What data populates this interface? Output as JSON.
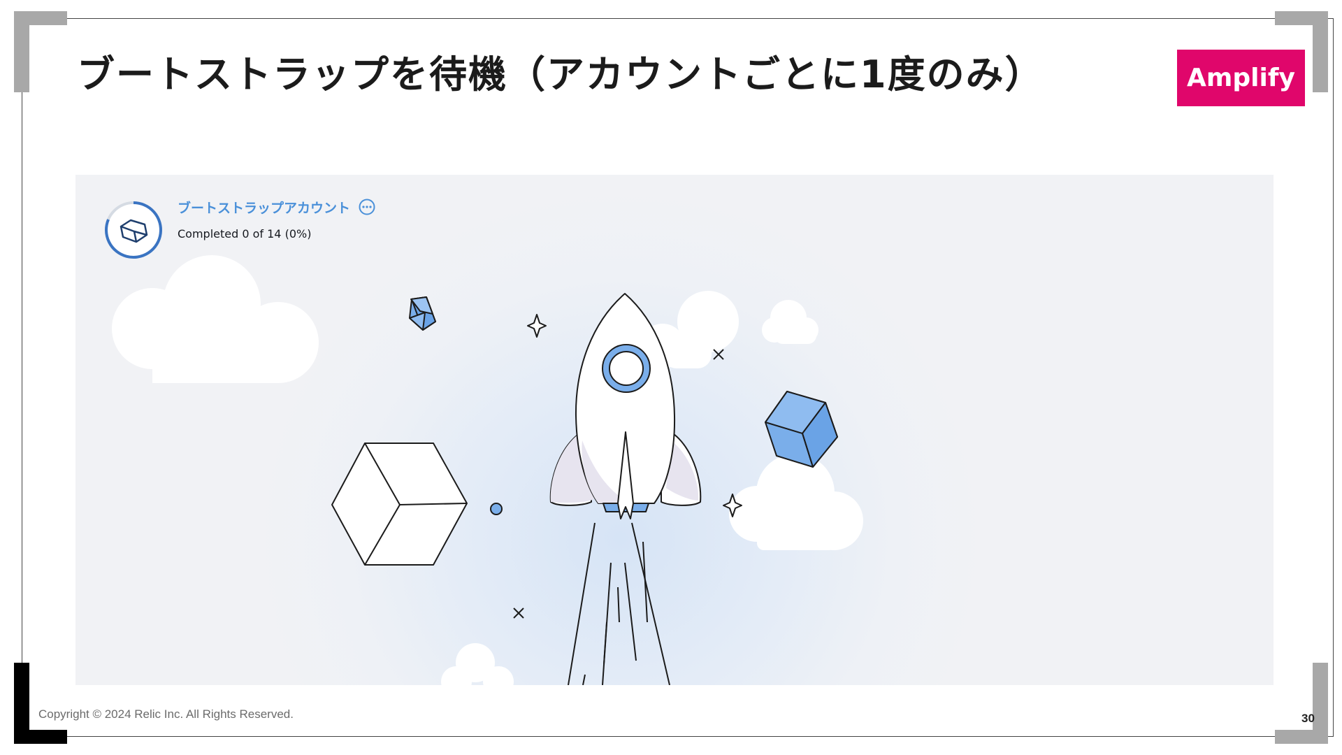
{
  "slide": {
    "title": "ブートストラップを待機（アカウントごとに1度のみ）",
    "badge": "Amplify",
    "footer": "Copyright © 2024 Relic Inc. All Rights Reserved.",
    "page_number": "30"
  },
  "progress": {
    "title": "ブートストラップアカウント",
    "status": "Completed 0 of 14 (0%)",
    "completed_fraction": 0.0,
    "icon": "cube-icon",
    "more_icon": "ellipsis-circle-icon"
  },
  "colors": {
    "badge": "#e0066b",
    "accent_blue": "#4a90d9",
    "cube_blue": "#7aaeea",
    "frame_gray": "#a8a8a8",
    "frame_black": "#000000"
  },
  "illustration": {
    "subject": "rocket-launch",
    "icons": [
      "rocket-icon",
      "cloud-icon",
      "cube-icon",
      "sparkle-icon",
      "cross-sparkle-icon"
    ]
  }
}
